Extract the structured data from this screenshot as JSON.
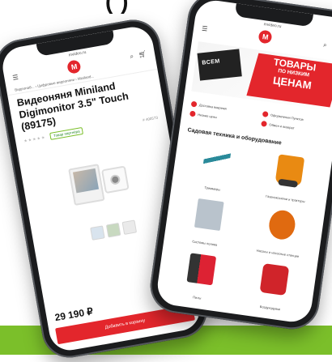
{
  "page": {
    "heading": "( )"
  },
  "left_phone": {
    "url": "mvideo.ru",
    "logo": "M",
    "breadcrumb": "Видеонаб... › Цифровые видеоняни › Miniland...",
    "title": "Видеоняня Miniland Digimonitor 3.5\" Touch (89175)",
    "stars": "★★★★★",
    "badge": "Товар партнёра",
    "sku": "# 400573",
    "price": "29 190 ₽",
    "cart_button": "Добавить в корзину",
    "icons": [
      "menu-icon",
      "search-icon",
      "cart-icon"
    ]
  },
  "right_phone": {
    "url": "mvideo.ru",
    "logo": "M",
    "banner": {
      "line1": "ТОВАРЫ",
      "line2": "ПО НИЗКИМ",
      "line3": "ЦЕНАМ",
      "stamp": "ВСЕМ"
    },
    "promos": [
      "Доставка вовремя",
      "Оформлении Пунктов",
      "Низкие цены",
      "Обмен и возврат"
    ],
    "section_title": "Садовая техника и оборудование",
    "categories": [
      "Триммеры",
      "Газонокосилки и тракторы",
      "Системы полива",
      "Насосы и насосные станции",
      "Пилы",
      "Воздуходувки"
    ]
  },
  "colors": {
    "brand_red": "#e3262c",
    "band_green": "#7bbf2a",
    "frame": "#1b1c1e"
  }
}
